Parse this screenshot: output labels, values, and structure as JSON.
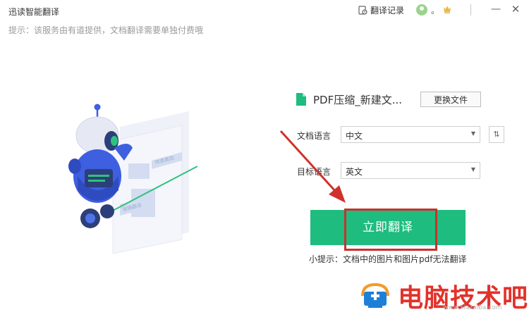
{
  "app": {
    "title": "迅读智能翻译",
    "history_label": "翻译记录",
    "user_name": "。",
    "minimize": "—",
    "close": "✕",
    "top_hint": "提示：该服务由有道提供，文档翻译需要单独付费哦"
  },
  "illustration": {
    "sign_top": "快速高效",
    "sign_bottom": "准确翻译"
  },
  "file": {
    "name": "PDF压缩_新建文...",
    "change_label": "更换文件"
  },
  "languages": {
    "source_label": "文档语言",
    "source_value": "中文",
    "target_label": "目标语言",
    "target_value": "英文",
    "swap_symbol": "⇅"
  },
  "action": {
    "translate_label": "立即翻译",
    "tip": "小提示：文档中的图片和图片pdf无法翻译"
  },
  "watermark": {
    "text": "电脑技术吧",
    "url": "www.xiazaiba.com"
  },
  "colors": {
    "primary_green": "#1ebc7f",
    "highlight_red": "#c8312d",
    "robot_blue": "#3d5fe0",
    "watermark_red": "#e2322a"
  }
}
